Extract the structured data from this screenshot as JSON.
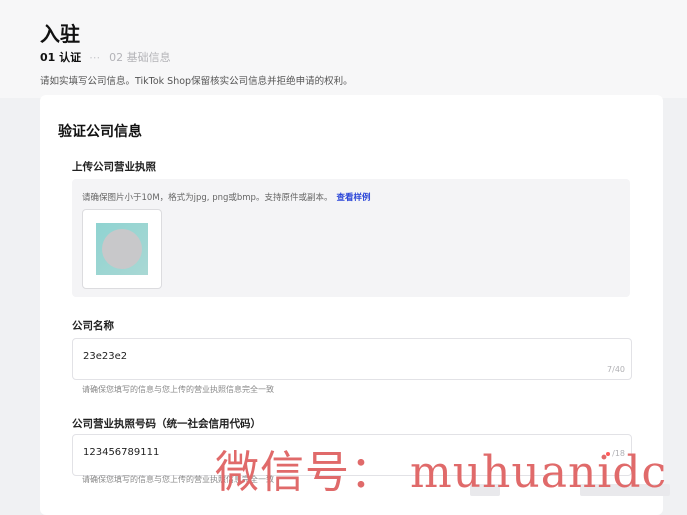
{
  "header": {
    "title": "入驻",
    "steps": [
      {
        "label": "01 认证"
      },
      {
        "label": "02 基础信息"
      }
    ],
    "step_separator": "⋯",
    "description": "请如实填写公司信息。TikTok Shop保留核实公司信息并拒绝申请的权利。"
  },
  "card": {
    "section_title": "验证公司信息",
    "license_upload": {
      "label": "上传公司营业执照",
      "hint": "请确保图片小于10M，格式为jpg, png或bmp。支持原件或副本。",
      "sample_link": "查看样例",
      "thumbnail_icon": "license-image-thumbnail"
    },
    "company_name": {
      "label": "公司名称",
      "value": "23e23e2",
      "count": "7/40",
      "help": "请确保您填写的信息与您上传的营业执照信息完全一致"
    },
    "license_number": {
      "label": "公司营业执照号码（统一社会信用代码）",
      "value": "123456789111",
      "count": "/18",
      "help": "请确保您填写的信息与您上传的营业执照信息完全一致"
    }
  },
  "watermark": "微信号： muhuanidc",
  "colors": {
    "link": "#2b46d8",
    "watermark": "#e06a6a",
    "error_dot": "#ff5a5a"
  }
}
